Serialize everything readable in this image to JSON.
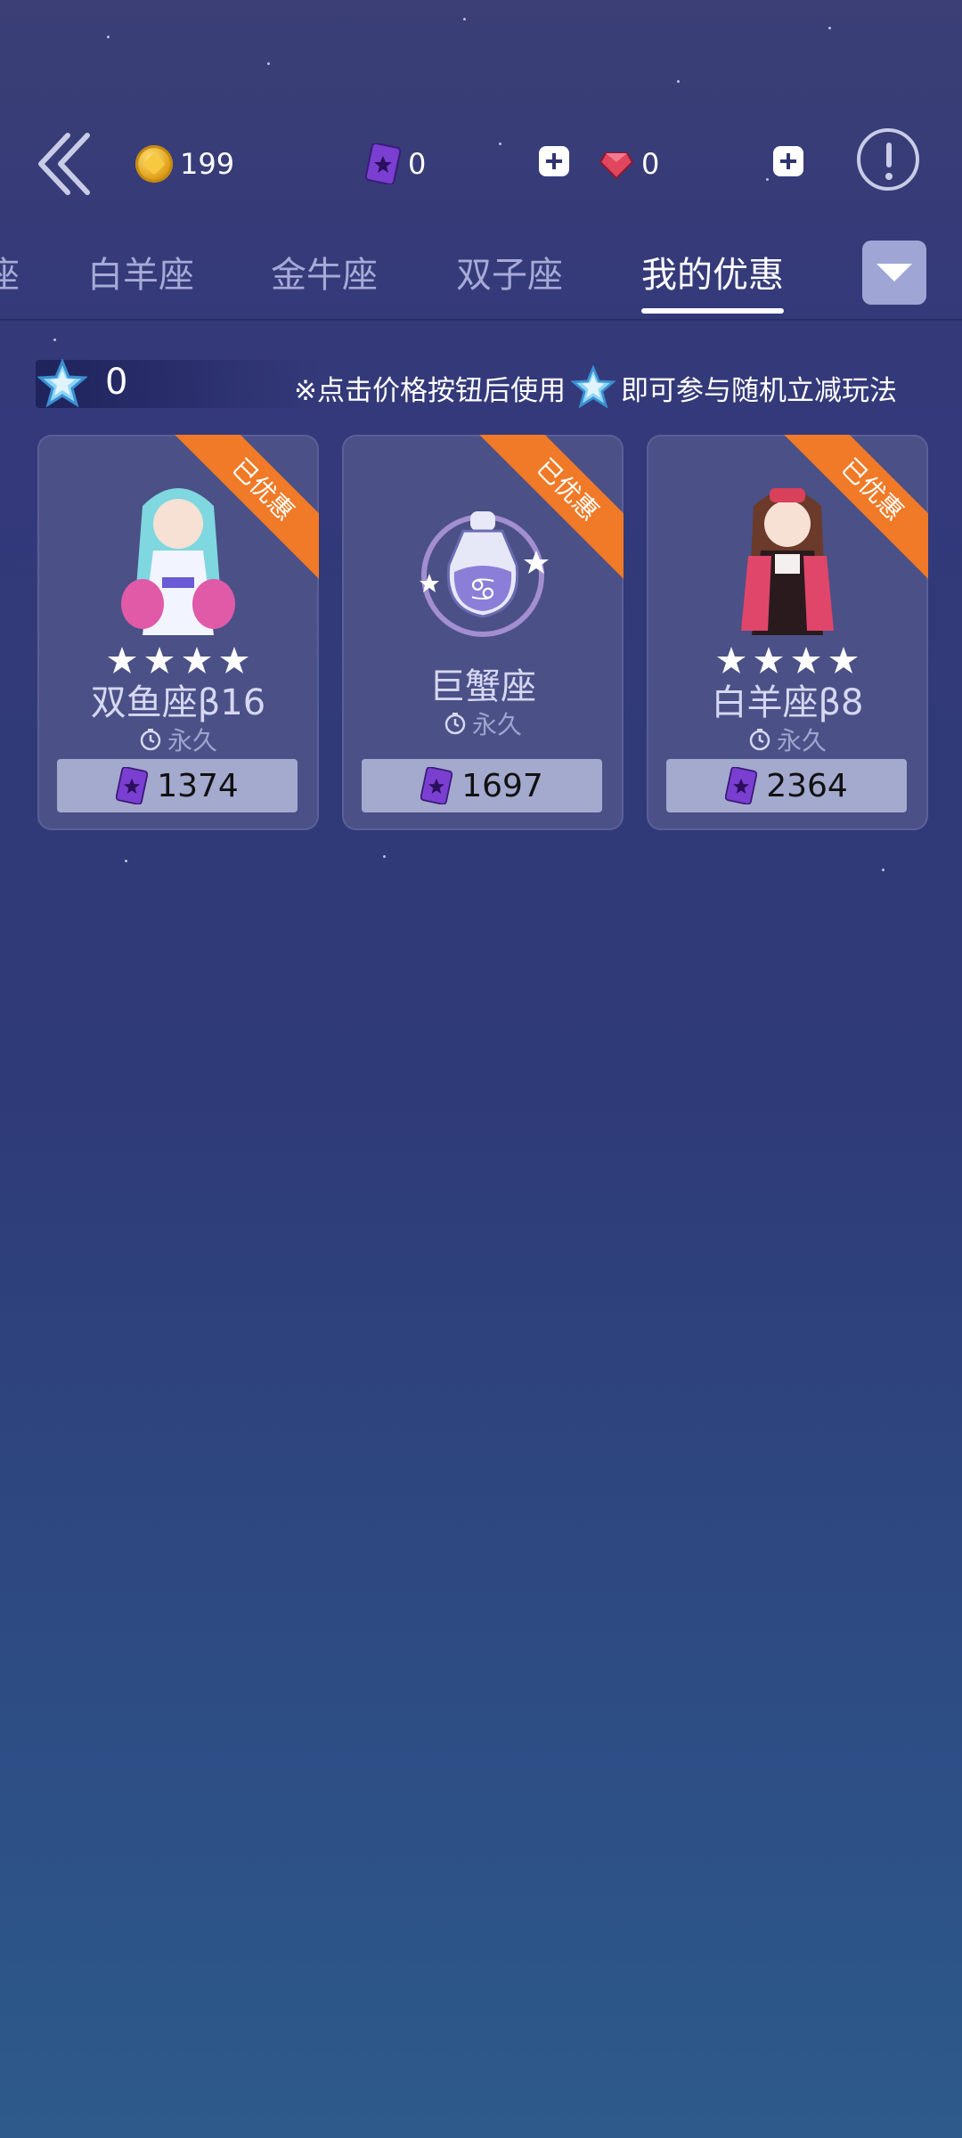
{
  "topbar": {
    "coins": "199",
    "cards": "0",
    "gems": "0"
  },
  "tabs": [
    {
      "label": "座"
    },
    {
      "label": "白羊座"
    },
    {
      "label": "金牛座"
    },
    {
      "label": "双子座"
    },
    {
      "label": "我的优惠"
    }
  ],
  "info": {
    "star_count": "0",
    "notice_part1": "※点击价格按钮后使用",
    "notice_part2": "即可参与随机立减玩法"
  },
  "cards": [
    {
      "badge": "已优惠",
      "name": "双鱼座β16",
      "duration": "永久",
      "price": "1374",
      "stars": 4
    },
    {
      "badge": "已优惠",
      "name": "巨蟹座",
      "duration": "永久",
      "price": "1697",
      "stars": 0
    },
    {
      "badge": "已优惠",
      "name": "白羊座β8",
      "duration": "永久",
      "price": "2364",
      "stars": 4
    }
  ],
  "colors": {
    "accent": "#f07a27",
    "card_bg": "#4b5087",
    "price_bg": "#a4a9ce"
  }
}
